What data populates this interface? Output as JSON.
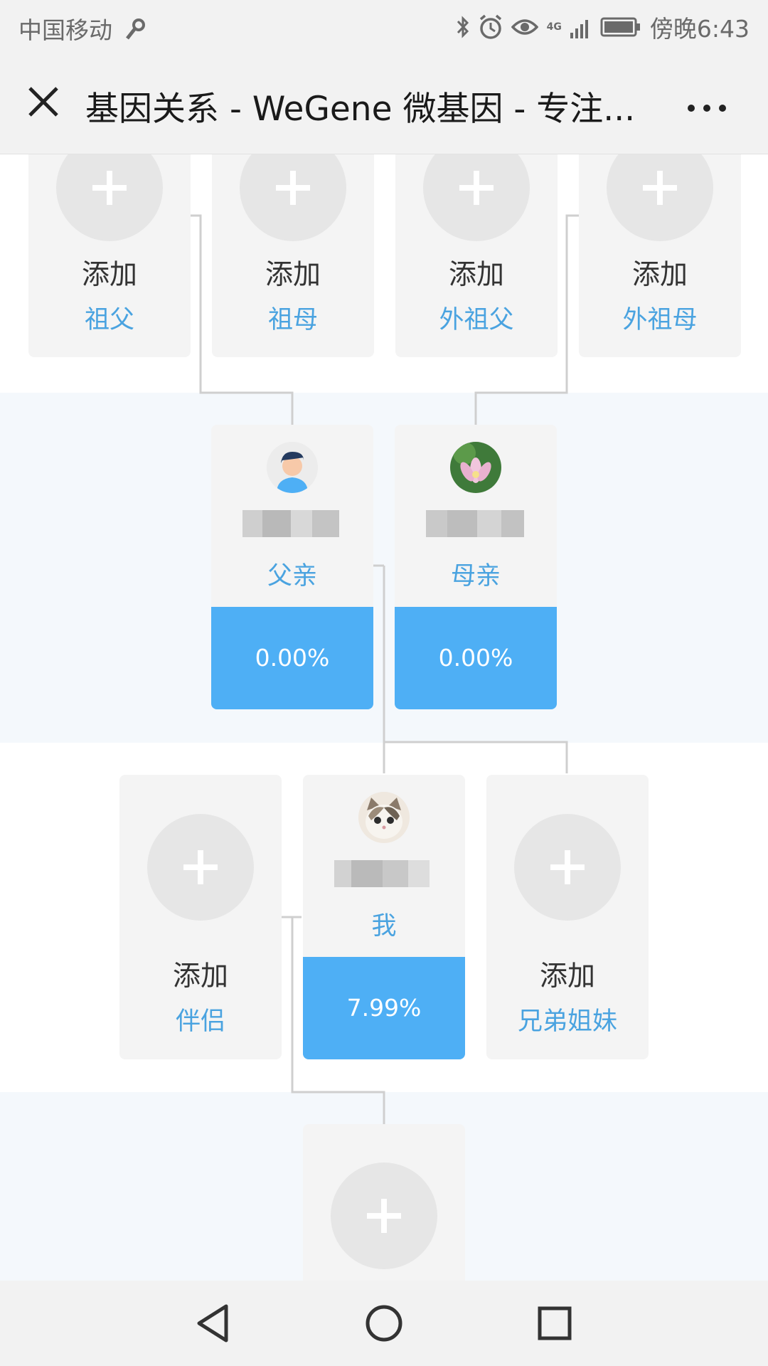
{
  "status_bar": {
    "carrier": "中国移动",
    "network": "4G",
    "time": "傍晚6:43"
  },
  "title_bar": {
    "title": "基因关系 - WeGene 微基因 - 专注..."
  },
  "icons": {
    "close": "close-icon",
    "more": "more-icon",
    "back": "back-triangle-icon",
    "home": "home-circle-icon",
    "recents": "recents-square-icon"
  },
  "colors": {
    "accent_blue": "#4eaff5",
    "role_text": "#4aa3e0",
    "card_bg": "#f4f4f4",
    "band_bg": "#f4f8fc"
  },
  "tree": {
    "grandparents": [
      {
        "action": "添加",
        "role": "祖父"
      },
      {
        "action": "添加",
        "role": "祖母"
      },
      {
        "action": "添加",
        "role": "外祖父"
      },
      {
        "action": "添加",
        "role": "外祖母"
      }
    ],
    "parents": [
      {
        "role": "父亲",
        "percent": "0.00%"
      },
      {
        "role": "母亲",
        "percent": "0.00%"
      }
    ],
    "self_row": {
      "partner": {
        "action": "添加",
        "role": "伴侣"
      },
      "me": {
        "role": "我",
        "percent": "7.99%"
      },
      "siblings": {
        "action": "添加",
        "role": "兄弟姐妹"
      }
    }
  }
}
